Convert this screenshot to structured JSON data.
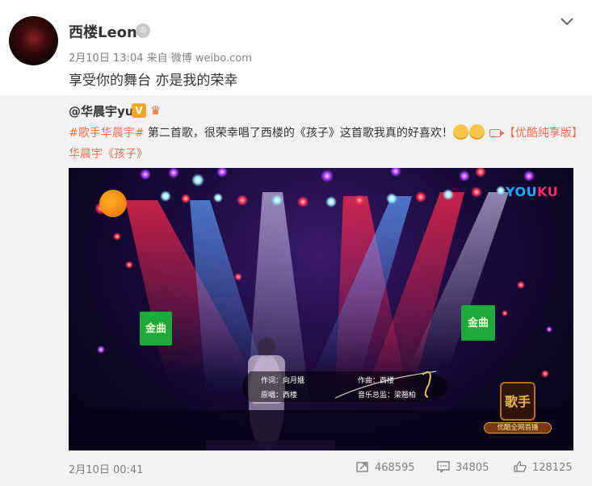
{
  "post": {
    "username": "西楼Leon",
    "time": "2月10日 13:04",
    "source": "来自 微博 weibo.com",
    "text": "享受你的舞台 亦是我的荣幸"
  },
  "repost": {
    "author": "@华晨宇yu",
    "hashtag": "#歌手华晨宇#",
    "text_main": " 第二首歌，很荣幸唱了西楼的《孩子》这首歌我真的好喜欢！",
    "link_text": "【优酷纯享版】华晨宇《孩子》",
    "video": {
      "watermark": "YOUKU",
      "credits": {
        "lyricist": "作词：向月娥",
        "composer": "作曲：西楼",
        "original_singer": "原唱：西楼",
        "music_director": "音乐总监：梁翘柏"
      },
      "show_logo": "歌手",
      "show_banner": "优酷全网首播"
    },
    "footer": {
      "date": "2月10日 00:41",
      "reposts": "468595",
      "comments": "34805",
      "likes": "128125"
    }
  }
}
